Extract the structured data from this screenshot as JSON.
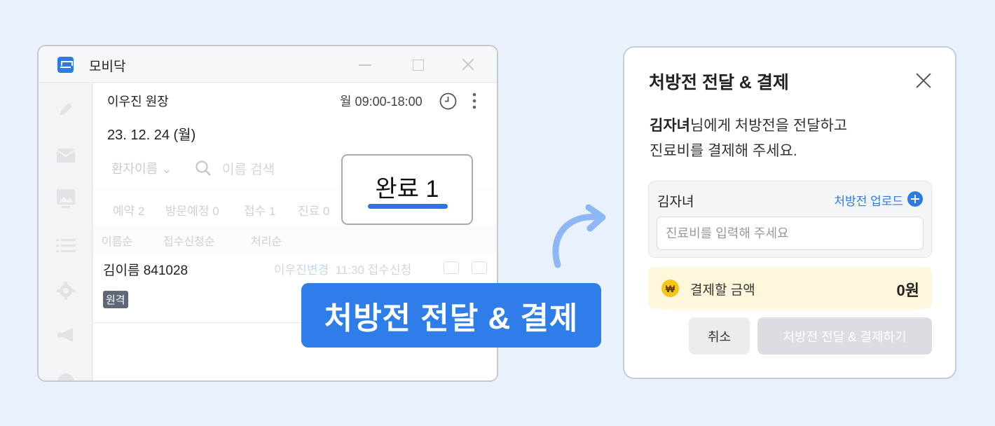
{
  "app": {
    "title": "모비닥",
    "doctor": "이우진 원장",
    "hours": "월 09:00-18:00",
    "date": "23. 12. 24 (월)",
    "patient_select": "환자이름",
    "search_placeholder": "이름 검색",
    "tabs": [
      "예약 2",
      "방문예정 0",
      "접수 1",
      "진료 0"
    ],
    "sort_options": [
      "이름순",
      "접수신청순",
      "처리순"
    ],
    "row": {
      "patient": "김이름 841028",
      "doctor": "이우진",
      "change": "변경",
      "time_status": "11:30 접수신청",
      "badge": "원격"
    },
    "sidebar_icons": [
      "pencil-icon",
      "mail-icon",
      "image-icon",
      "list-icon",
      "gear-icon",
      "megaphone-icon",
      "chat-icon"
    ]
  },
  "done_card": {
    "label": "완료 1"
  },
  "cta": {
    "label": "처방전 전달 & 결제"
  },
  "dialog": {
    "title": "처방전 전달 & 결제",
    "patient_name_bold": "김자녀",
    "message_rest": "님에게 처방전을 전달하고",
    "message_line2": "진료비를 결제해 주세요.",
    "patient_name": "김자녀",
    "upload_label": "처방전 업로드",
    "fee_placeholder": "진료비를 입력해 주세요",
    "amount_label": "결제할 금액",
    "amount_value": "0원",
    "won_symbol": "₩",
    "cancel_label": "취소",
    "submit_label": "처방전 전달 & 결제하기"
  },
  "colors": {
    "accent": "#2f7de8",
    "background": "#e9f1fc",
    "amount_bg": "#fff7dc",
    "coin": "#f7c514"
  }
}
